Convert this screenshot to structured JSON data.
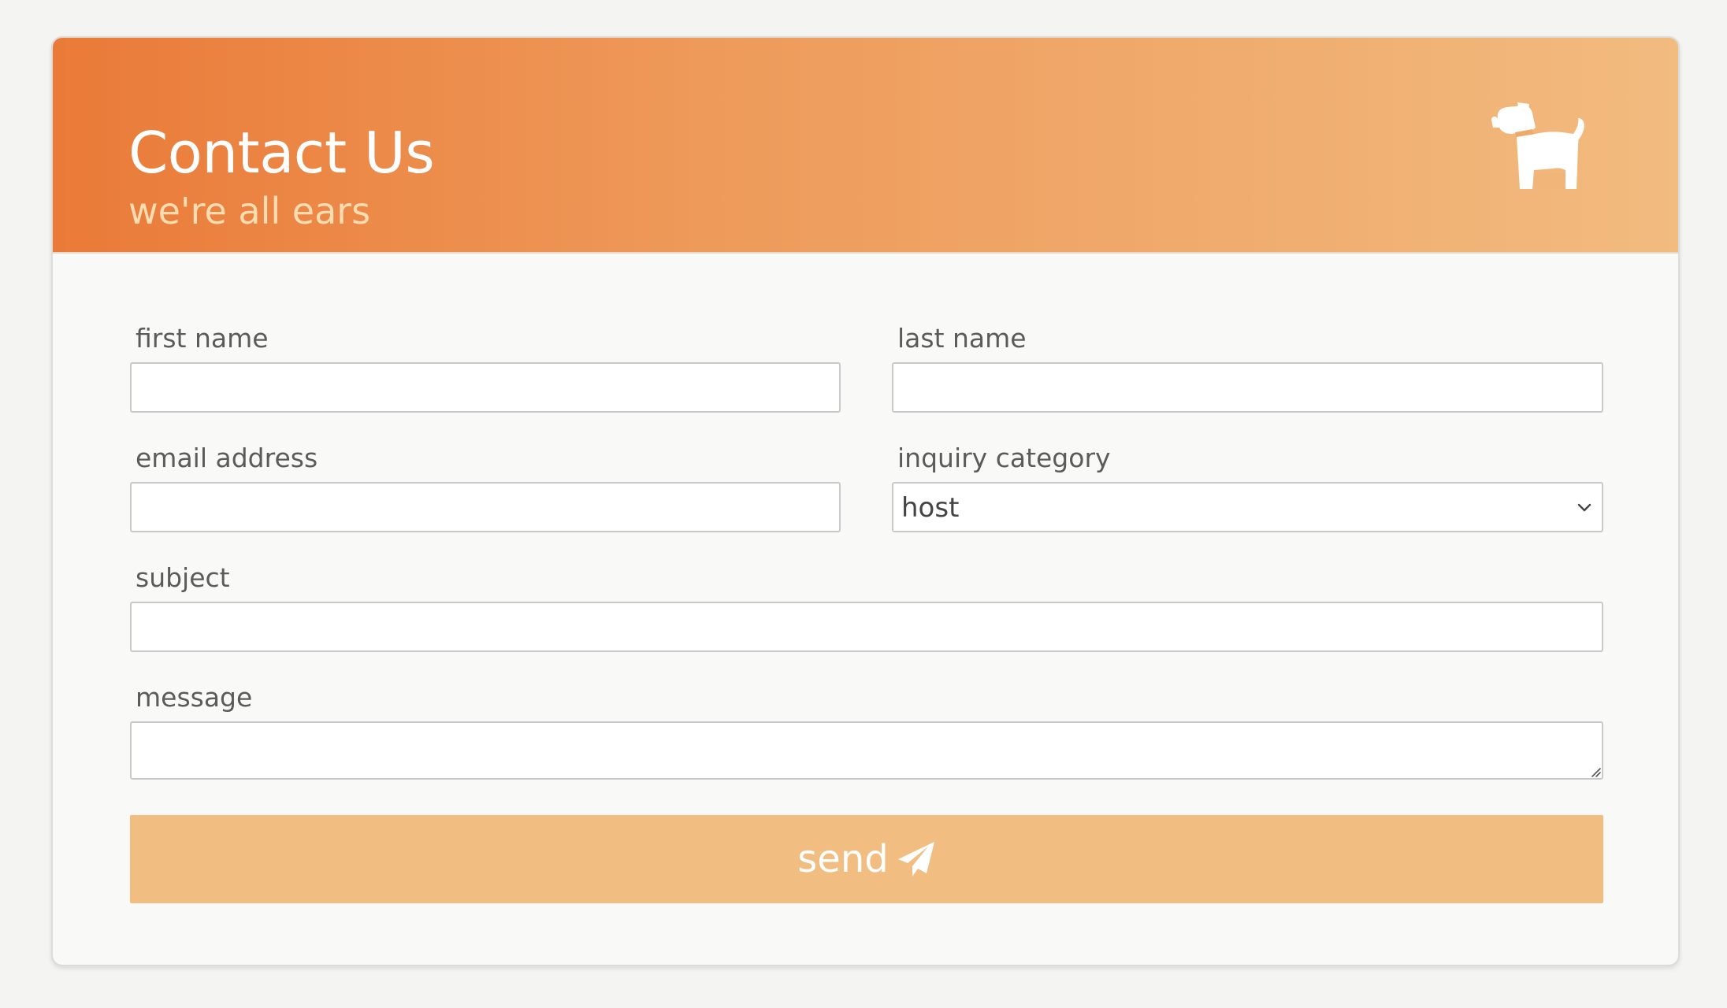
{
  "header": {
    "title": "Contact Us",
    "subtitle": "we're all ears",
    "icon": "dog-icon"
  },
  "form": {
    "first_name": {
      "label": "first name",
      "value": "",
      "placeholder": ""
    },
    "last_name": {
      "label": "last name",
      "value": "",
      "placeholder": ""
    },
    "email": {
      "label": "email address",
      "value": "",
      "placeholder": ""
    },
    "category": {
      "label": "inquiry category",
      "selected": "host",
      "icon": "chevron-down-icon"
    },
    "subject": {
      "label": "subject",
      "value": "",
      "placeholder": ""
    },
    "message": {
      "label": "message",
      "value": "",
      "placeholder": ""
    }
  },
  "send_button": {
    "label": "send",
    "icon": "paper-plane-icon"
  },
  "colors": {
    "header_gradient_start": "#ea7a38",
    "header_gradient_end": "#f2bb7f",
    "subtitle": "#fcdcb0",
    "button": "#f2bd80",
    "page_background": "#f4f4f3",
    "card_background": "#f9f9f8"
  }
}
